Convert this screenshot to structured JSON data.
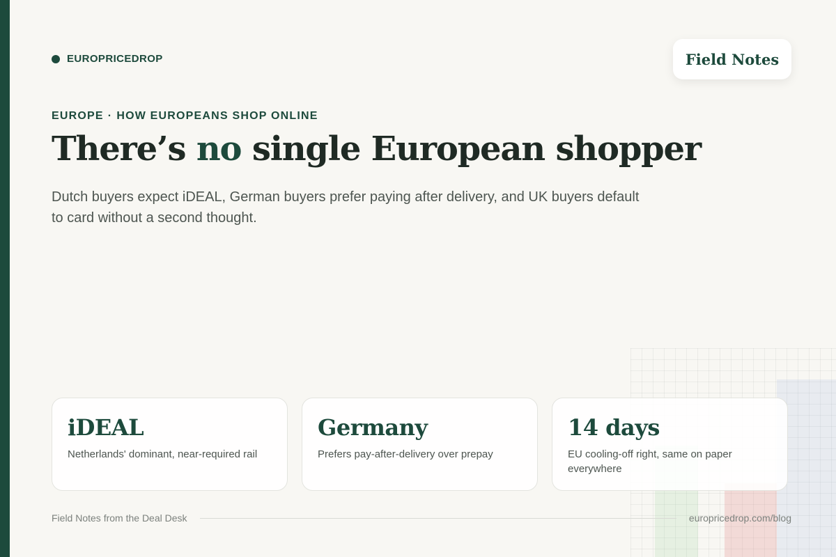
{
  "brand": {
    "name": "EUROPRICEDROP"
  },
  "badge": {
    "label": "Field Notes"
  },
  "eyebrow": {
    "region": "EUROPE",
    "separator": "·",
    "topic": "HOW EUROPEANS SHOP ONLINE"
  },
  "headline": {
    "before": "There’s ",
    "accent": "no",
    "after": " single European shopper"
  },
  "subhead": "Dutch buyers expect iDEAL, German buyers prefer paying after delivery, and UK buyers default to card without a second thought.",
  "cards": [
    {
      "title": "iDEAL",
      "text": "Netherlands' dominant, near-required rail"
    },
    {
      "title": "Germany",
      "text": "Prefers pay-after-delivery over prepay"
    },
    {
      "title": "14 days",
      "text": "EU cooling-off right, same on paper everywhere"
    }
  ],
  "footer": {
    "left": "Field Notes from the Deal Desk",
    "right": "europricedrop.com/blog"
  },
  "colors": {
    "accent": "#1d4a3c",
    "background": "#f8f7f3",
    "text": "#1f2a24",
    "muted": "#4d5550"
  }
}
